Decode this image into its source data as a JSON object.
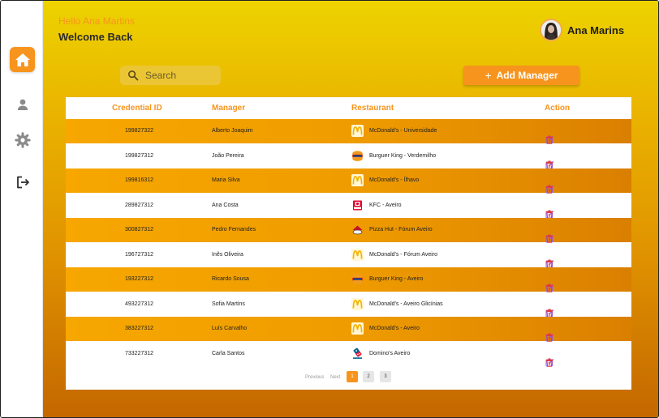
{
  "header": {
    "greeting": "Hello Ana Martins",
    "welcome": "Welcome Back",
    "user_name": "Ana Marins"
  },
  "sidebar": {
    "items": [
      {
        "icon": "home-icon",
        "active": true
      },
      {
        "icon": "user-icon",
        "active": false
      },
      {
        "icon": "gear-icon",
        "active": false
      },
      {
        "icon": "logout-icon",
        "active": false
      }
    ]
  },
  "search": {
    "placeholder": "Search"
  },
  "add_button": {
    "icon": "plus-icon",
    "label": "Add Manager"
  },
  "table": {
    "columns": [
      "Credential ID",
      "Manager",
      "Restaurant",
      "Action"
    ],
    "rows": [
      {
        "id": "199827322",
        "manager": "Alberto Joaquim",
        "restaurant": "McDonald's - Universidade",
        "logo": "mcdonalds"
      },
      {
        "id": "199827312",
        "manager": "João Pereira",
        "restaurant": "Burguer King -    Verdemilho",
        "logo": "burger-king"
      },
      {
        "id": "199816312",
        "manager": "Maria Silva",
        "restaurant": "McDonald's - Ílhavo",
        "logo": "mcdonalds"
      },
      {
        "id": "289827312",
        "manager": "Ana Costa",
        "restaurant": "KFC - Aveiro",
        "logo": "kfc"
      },
      {
        "id": "300827312",
        "manager": "Pedro Fernandes",
        "restaurant": "Pizza Hut - Fórum Aveiro",
        "logo": "pizza-hut"
      },
      {
        "id": "196727312",
        "manager": "Inês Oliveira",
        "restaurant": "McDonald's - Fórum Aveiro",
        "logo": "mcdonalds"
      },
      {
        "id": "193227312",
        "manager": "Ricardo Sousa",
        "restaurant": "Burguer King -  Aveiro",
        "logo": "burger-king"
      },
      {
        "id": "493227312",
        "manager": "Sofia Martins",
        "restaurant": "McDonald's - Aveiro Glicínias",
        "logo": "mcdonalds"
      },
      {
        "id": "383227312",
        "manager": "Luís Carvalho",
        "restaurant": "McDonald's - Aveiro",
        "logo": "mcdonalds"
      },
      {
        "id": "733227312",
        "manager": "Carla Santos",
        "restaurant": "Domino's Aveiro",
        "logo": "dominos"
      }
    ]
  },
  "pagination": {
    "previous": "Previous",
    "next": "Next",
    "pages": [
      "1",
      "2",
      "3"
    ],
    "current": "1"
  },
  "colors": {
    "accent": "#f7941d",
    "edit_icon": "#8b5cf6",
    "delete_icon": "#e53935"
  }
}
